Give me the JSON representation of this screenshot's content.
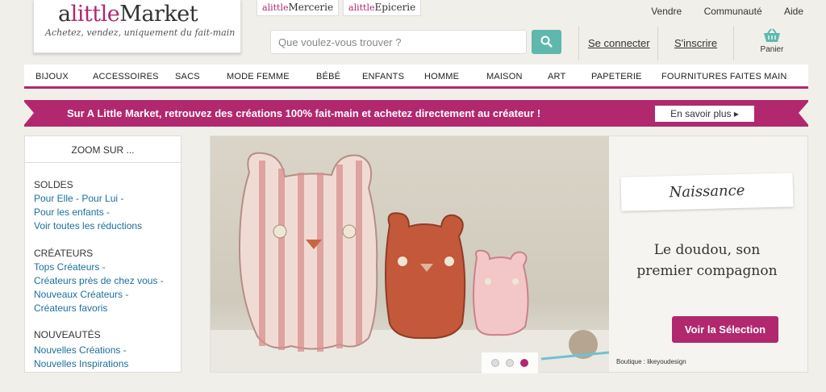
{
  "logo": {
    "name_a": "a",
    "name_little": "little",
    "name_market": "Market",
    "tagline": "Achetez, vendez, uniquement du fait-main"
  },
  "subsites": [
    {
      "prefix": "a",
      "little": "little",
      "name": "Mercerie"
    },
    {
      "prefix": "a",
      "little": "little",
      "name": "Epicerie"
    }
  ],
  "top_links": [
    "Vendre",
    "Communauté",
    "Aide"
  ],
  "search": {
    "placeholder": "Que voulez-vous trouver ?",
    "icon": "search-icon"
  },
  "account": {
    "login": "Se connecter",
    "signup": "S'inscrire",
    "cart": "Panier"
  },
  "nav": [
    "BIJOUX",
    "ACCESSOIRES",
    "SACS",
    "MODE FEMME",
    "BÉBÉ",
    "ENFANTS",
    "HOMME",
    "MAISON",
    "ART",
    "PAPETERIE",
    "FOURNITURES FAITES MAIN"
  ],
  "banner": {
    "text": "Sur A Little Market, retrouvez des créations 100% fait-main et achetez directement au créateur !",
    "button": "En savoir plus"
  },
  "sidebar": {
    "title": "ZOOM SUR ...",
    "sections": [
      {
        "title": "SOLDES",
        "links": [
          "Pour Elle - Pour Lui -",
          "Pour les enfants -",
          "Voir toutes les réductions"
        ]
      },
      {
        "title": "CRÉATEURS",
        "links": [
          "Tops Créateurs -",
          "Créateurs près de chez vous -",
          "Nouveaux Créateurs -",
          "Créateurs favoris"
        ]
      },
      {
        "title": "NOUVEAUTÉS",
        "links": [
          "Nouvelles Créations -",
          "Nouvelles Inspirations"
        ]
      }
    ]
  },
  "hero": {
    "label": "Naissance",
    "caption_line1": "Le doudou, son",
    "caption_line2": "premier compagnon",
    "cta": "Voir la Sélection",
    "credit": "Boutique : likeyoudesign",
    "active_slide": 3,
    "slide_count": 3
  },
  "colors": {
    "brand": "#b1286f",
    "search_button": "#5fb8ad",
    "link": "#1a6f9f",
    "background": "#f0efe9"
  }
}
